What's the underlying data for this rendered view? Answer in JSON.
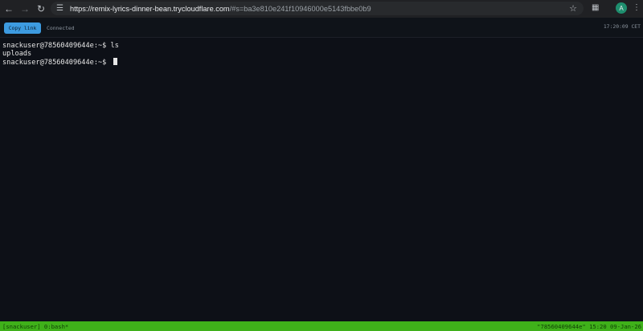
{
  "browser": {
    "url_host": "https://remix-lyrics-dinner-bean.trycloudflare.com",
    "url_rest": "/#s=ba3e810e241f10946000e5143fbbe0b9",
    "profile_initial": "A"
  },
  "app": {
    "copy_link_label": "Copy link",
    "status": "Connected",
    "clock": "17:20:09 CET"
  },
  "terminal": {
    "lines": [
      "snackuser@78560409644e:~$ ls",
      "uploads"
    ],
    "prompt": "snackuser@78560409644e:~$ "
  },
  "tmux": {
    "left": "[snackuser] 0:bash*",
    "right": "\"78560409644e\" 15:20 09-Jan-26"
  },
  "colors": {
    "accent": "#3d9be0",
    "status_bar": "#3fb11a",
    "terminal_bg": "#0d1017"
  }
}
